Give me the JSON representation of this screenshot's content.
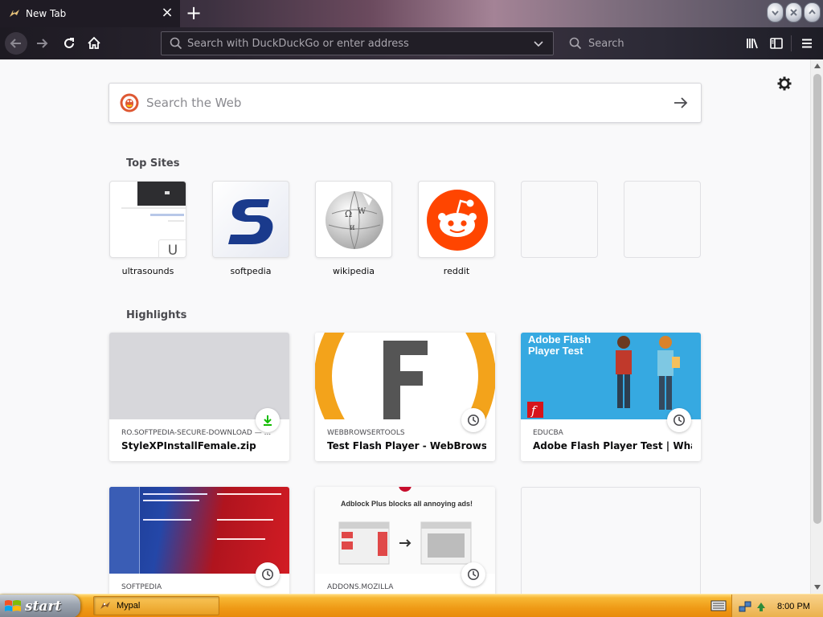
{
  "tab": {
    "title": "New Tab",
    "close": "×"
  },
  "new_tab_button": "+",
  "urlbar": {
    "placeholder": "Search with DuckDuckGo or enter address"
  },
  "searchbar": {
    "placeholder": "Search"
  },
  "web_search": {
    "placeholder": "Search the Web"
  },
  "top_sites": {
    "title": "Top Sites",
    "items": [
      {
        "label": "ultrasounds",
        "icon": "ultrasounds-thumbnail",
        "letter": "U"
      },
      {
        "label": "softpedia",
        "icon": "softpedia-logo"
      },
      {
        "label": "wikipedia",
        "icon": "wikipedia-globe-logo"
      },
      {
        "label": "reddit",
        "icon": "reddit-alien-logo"
      },
      {
        "label": "",
        "icon": ""
      },
      {
        "label": "",
        "icon": ""
      }
    ]
  },
  "highlights": {
    "title": "Highlights",
    "items": [
      {
        "host": "RO.SOFTPEDIA-SECURE-DOWNLOAD — ...",
        "title": "StyleXPInstallFemale.zip",
        "badge": "download-icon"
      },
      {
        "host": "WEBBROWSERTOOLS",
        "title": "Test Flash Player - WebBrowser...",
        "badge": "clock-icon"
      },
      {
        "host": "EDUCBA",
        "title": "Adobe Flash Player Test | What is...",
        "badge": "clock-icon",
        "thumb_text": "Adobe Flash Player Test"
      },
      {
        "host": "SOFTPEDIA",
        "title": "",
        "badge": "clock-icon"
      },
      {
        "host": "ADDONS.MOZILLA",
        "title": "",
        "badge": "clock-icon",
        "thumb_text": "Adblock Plus blocks all annoying ads!"
      },
      {
        "host": "",
        "title": ""
      }
    ]
  },
  "taskbar": {
    "start_label": "start",
    "task_label": "Mypal",
    "clock": "8:00 PM"
  },
  "colors": {
    "accent_orange": "#f7a51f",
    "reddit": "#ff4500",
    "softpedia_blue": "#1a3a8c",
    "educba_blue": "#36a9e1"
  }
}
